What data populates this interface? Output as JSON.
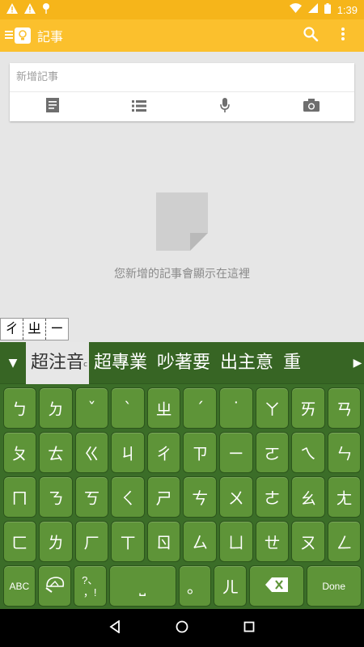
{
  "status": {
    "time": "1:39"
  },
  "appbar": {
    "title": "記事"
  },
  "note_input": {
    "placeholder": "新增記事"
  },
  "empty_state": {
    "message": "您新增的記事會顯示在這裡"
  },
  "composition": {
    "chars": [
      "ㄔ",
      "ㄓ",
      "ㄧ"
    ]
  },
  "candidates": {
    "items": [
      "超注音",
      "超專業",
      "吵著要",
      "出主意",
      "重"
    ]
  },
  "keyboard": {
    "row1": [
      "ㄅ",
      "ㄉ",
      "ˇ",
      "ˋ",
      "ㄓ",
      "ˊ",
      "˙",
      "ㄚ",
      "ㄞ",
      "ㄢ"
    ],
    "row2": [
      "ㄆ",
      "ㄊ",
      "ㄍ",
      "ㄐ",
      "ㄔ",
      "ㄗ",
      "ㄧ",
      "ㄛ",
      "ㄟ",
      "ㄣ"
    ],
    "row3": [
      "ㄇ",
      "ㄋ",
      "ㄎ",
      "ㄑ",
      "ㄕ",
      "ㄘ",
      "ㄨ",
      "ㄜ",
      "ㄠ",
      "ㄤ"
    ],
    "row4": [
      "ㄈ",
      "ㄌ",
      "ㄏ",
      "ㄒ",
      "ㄖ",
      "ㄙ",
      "ㄩ",
      "ㄝ",
      "ㄡ",
      "ㄥ"
    ],
    "abc": "ABC",
    "punct_top": "?、",
    "punct_bottom": "，!",
    "space": "⎵",
    "circle": "。",
    "er": "ㄦ",
    "done": "Done"
  }
}
